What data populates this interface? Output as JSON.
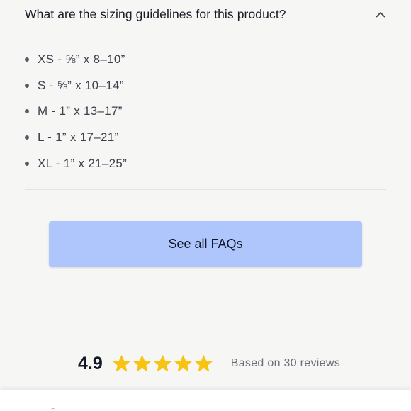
{
  "faq": {
    "question": "What are the sizing guidelines for this product?",
    "toggle_icon": "chevron-up-icon",
    "sizes": [
      {
        "label": "XS - ⅝” x 8–10”"
      },
      {
        "label": "S - ⅝” x 10–14”"
      },
      {
        "label": "M - 1” x 13–17”"
      },
      {
        "label": "L - 1” x 17–21”"
      },
      {
        "label": "XL - 1” x 21–25”"
      }
    ],
    "see_all_label": "See all FAQs"
  },
  "reviews": {
    "rating": "4.9",
    "stars": 5,
    "summary": "Based on 30 reviews"
  },
  "colors": {
    "background": "#f6f6f5",
    "button": "#aec6fb",
    "star": "#f9c312",
    "text": "#1d1f2b"
  }
}
